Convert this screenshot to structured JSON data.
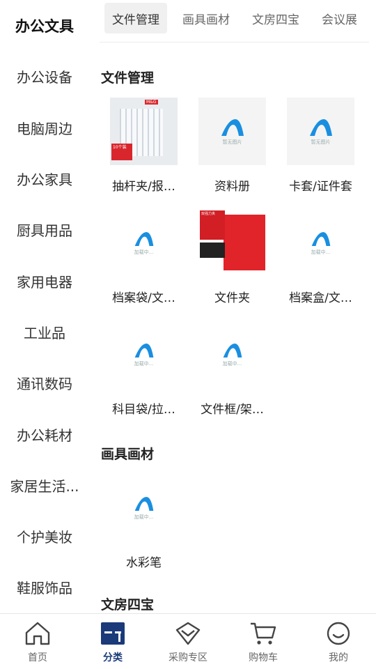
{
  "sidebar": {
    "items": [
      {
        "label": "办公文具",
        "active": true
      },
      {
        "label": "办公设备"
      },
      {
        "label": "电脑周边"
      },
      {
        "label": "办公家具"
      },
      {
        "label": "厨具用品"
      },
      {
        "label": "家用电器"
      },
      {
        "label": "工业品"
      },
      {
        "label": "通讯数码"
      },
      {
        "label": "办公耗材"
      },
      {
        "label": "家居生活..."
      },
      {
        "label": "个护美妆"
      },
      {
        "label": "鞋服饰品"
      }
    ]
  },
  "tabs": [
    "文件管理",
    "画具画材",
    "文房四宝",
    "会议展"
  ],
  "sections": [
    {
      "title": "文件管理",
      "items": [
        {
          "label": "抽杆夹/报…"
        },
        {
          "label": "资料册",
          "placeholder_caption": "暂无图片"
        },
        {
          "label": "卡套/证件套",
          "placeholder_caption": "暂无图片"
        },
        {
          "label": "档案袋/文…",
          "placeholder_caption": "加载中..."
        },
        {
          "label": "文件夹"
        },
        {
          "label": "档案盒/文…",
          "placeholder_caption": "加载中..."
        },
        {
          "label": "科目袋/拉…",
          "placeholder_caption": "加载中..."
        },
        {
          "label": "文件框/架…",
          "placeholder_caption": "加载中..."
        }
      ]
    },
    {
      "title": "画具画材",
      "items": [
        {
          "label": "水彩笔",
          "placeholder_caption": "加载中..."
        }
      ]
    },
    {
      "title": "文房四宝",
      "items": []
    }
  ],
  "product_images": {
    "binder": {
      "badge": "10个装",
      "brand": "M&G"
    },
    "folder": {
      "title": "双强力夹"
    }
  },
  "bottom_nav": [
    {
      "label": "首页",
      "icon": "home-icon"
    },
    {
      "label": "分类",
      "icon": "category-icon",
      "active": true
    },
    {
      "label": "采购专区",
      "icon": "purchase-icon"
    },
    {
      "label": "购物车",
      "icon": "cart-icon"
    },
    {
      "label": "我的",
      "icon": "profile-icon"
    }
  ],
  "colors": {
    "accent": "#1a3a7a",
    "logo_blue": "#1a8fe0"
  }
}
